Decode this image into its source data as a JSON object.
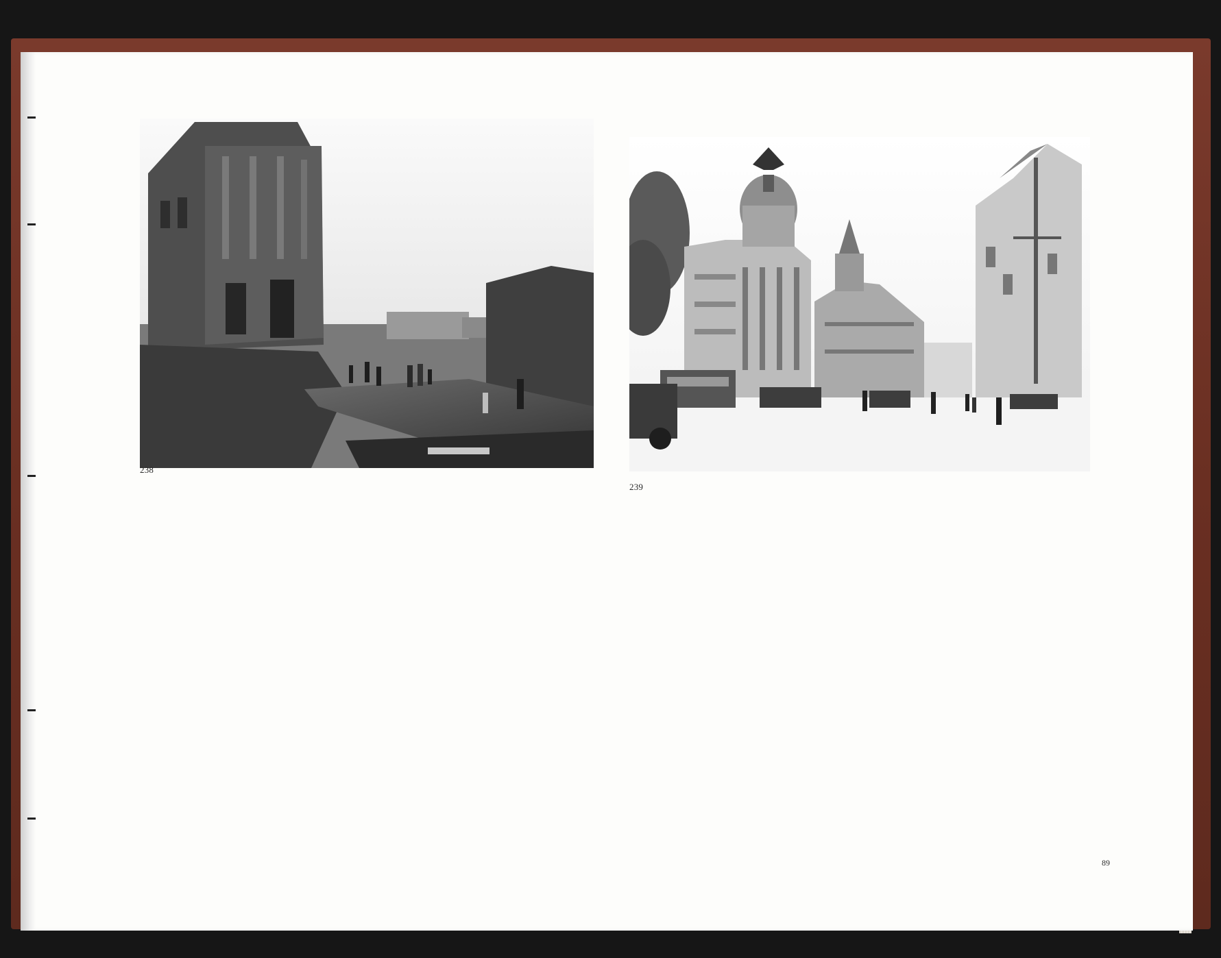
{
  "page": {
    "figures": [
      {
        "number": "238"
      },
      {
        "number": "239"
      }
    ],
    "folio": "89"
  }
}
